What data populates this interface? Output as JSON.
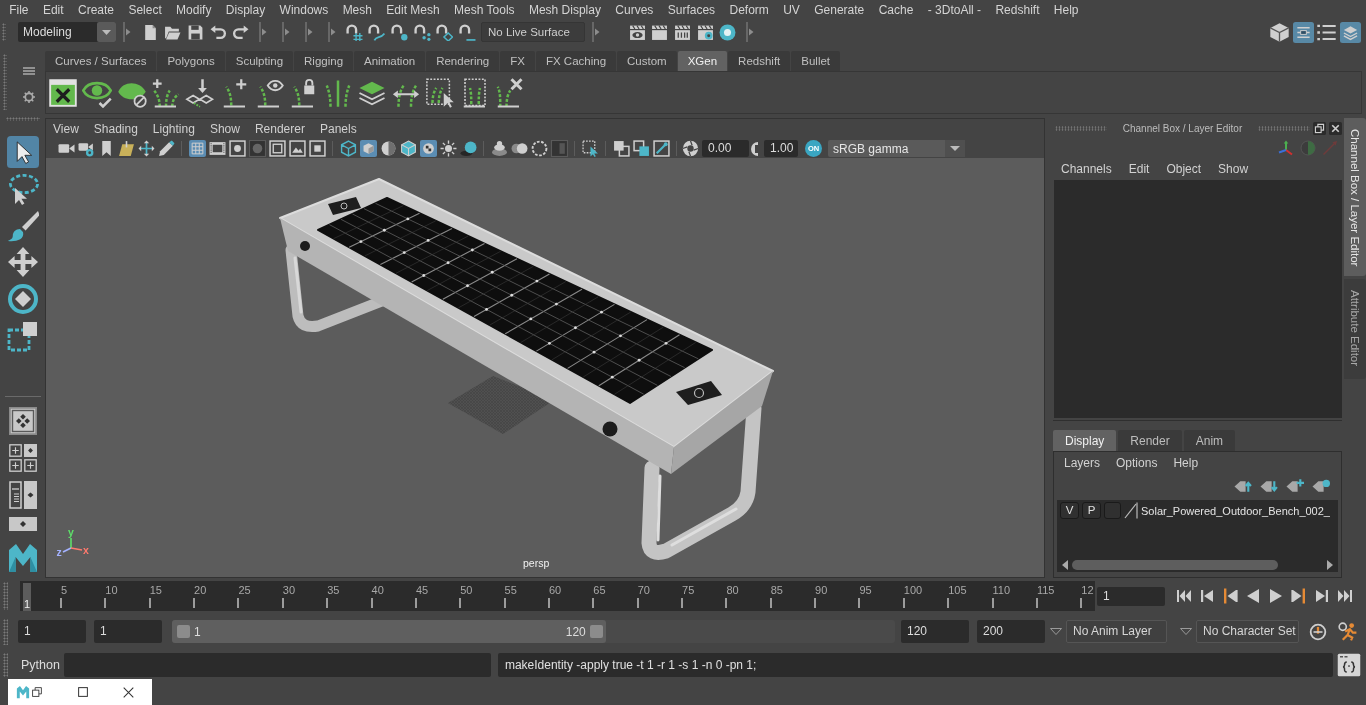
{
  "menu_bar": [
    "File",
    "Edit",
    "Create",
    "Select",
    "Modify",
    "Display",
    "Windows",
    "Mesh",
    "Edit Mesh",
    "Mesh Tools",
    "Mesh Display",
    "Curves",
    "Surfaces",
    "Deform",
    "UV",
    "Generate",
    "Cache",
    "- 3DtoAll -",
    "Redshift",
    "Help"
  ],
  "status_line": {
    "workspace": "Modeling",
    "live_surface": "No Live Surface",
    "panel_toggles": [
      {
        "selected": false
      },
      {
        "selected": true
      },
      {
        "selected": false
      },
      {
        "selected": true
      }
    ]
  },
  "shelf": {
    "tabs": [
      {
        "label": "Curves / Surfaces",
        "selected": false
      },
      {
        "label": "Polygons",
        "selected": false
      },
      {
        "label": "Sculpting",
        "selected": false
      },
      {
        "label": "Rigging",
        "selected": false
      },
      {
        "label": "Animation",
        "selected": false
      },
      {
        "label": "Rendering",
        "selected": false
      },
      {
        "label": "FX",
        "selected": false
      },
      {
        "label": "FX Caching",
        "selected": false
      },
      {
        "label": "Custom",
        "selected": false
      },
      {
        "label": "XGen",
        "selected": true
      },
      {
        "label": "Redshift",
        "selected": false
      },
      {
        "label": "Bullet",
        "selected": false
      }
    ]
  },
  "toolbox": {
    "tools": [
      {
        "selected": true
      },
      {
        "selected": false
      },
      {
        "selected": false
      },
      {
        "selected": false
      },
      {
        "selected": false
      },
      {
        "selected": false
      }
    ]
  },
  "viewport": {
    "menus": [
      "View",
      "Shading",
      "Lighting",
      "Show",
      "Renderer",
      "Panels"
    ],
    "toolbar": [
      {
        "selected": false
      },
      {
        "selected": false
      },
      {
        "selected": false
      },
      {
        "selected": false
      },
      {
        "selected": false
      },
      {
        "selected": false
      },
      {
        "selected": true
      },
      {
        "selected": false
      },
      {
        "selected": false
      },
      {
        "selected": false
      },
      {
        "selected": false
      },
      {
        "selected": false
      },
      {
        "selected": false
      },
      {
        "selected": false
      },
      {
        "selected": true
      },
      {
        "selected": false
      },
      {
        "selected": false
      },
      {
        "selected": true
      },
      {
        "selected": false
      },
      {
        "selected": false
      },
      {
        "selected": false
      },
      {
        "selected": false
      },
      {
        "selected": false
      },
      {
        "selected": false
      },
      {
        "selected": false
      },
      {
        "selected": false
      },
      {
        "selected": false
      },
      {
        "selected": false
      }
    ],
    "exposure": "0.00",
    "gamma": "1.00",
    "color_management": "ON",
    "color_space": "sRGB gamma",
    "axis_gizmo": [
      {
        "label": "y",
        "color": "#5ee06a"
      },
      {
        "label": "z",
        "color": "#a4b2ff"
      },
      {
        "label": "x",
        "color": "#ff7a6e"
      }
    ],
    "camera": "persp"
  },
  "channel_box": {
    "title": "Channel Box / Layer Editor",
    "menus": [
      "Channels",
      "Edit",
      "Object",
      "Show"
    ]
  },
  "layer_editor": {
    "tabs": [
      {
        "label": "Display",
        "selected": true
      },
      {
        "label": "Render",
        "selected": false
      },
      {
        "label": "Anim",
        "selected": false
      }
    ],
    "menus": [
      "Layers",
      "Options",
      "Help"
    ],
    "layers": [
      {
        "visibility": "V",
        "playback": "P",
        "name": "Solar_Powered_Outdoor_Bench_002_"
      }
    ]
  },
  "side_tabs": [
    {
      "label": "Channel Box / Layer Editor",
      "selected": true
    },
    {
      "label": "Attribute Editor",
      "selected": false
    }
  ],
  "time_slider": {
    "ticks": [
      "5",
      "10",
      "15",
      "20",
      "25",
      "30",
      "35",
      "40",
      "45",
      "50",
      "55",
      "60",
      "65",
      "70",
      "75",
      "80",
      "85",
      "90",
      "95",
      "100",
      "105",
      "110",
      "115",
      "12"
    ],
    "current_frame": "1",
    "level": 0,
    "frame_field": "1"
  },
  "range_slider": {
    "start": "1",
    "playback_start": "1",
    "range_start": "1",
    "range_end": "120",
    "level": 0.6,
    "playback_end": "120",
    "end": "200",
    "anim_layer": "No Anim Layer",
    "character_set": "No Character Set"
  },
  "command_line": {
    "language": "Python",
    "result": "makeIdentity -apply true -t 1 -r 1 -s 1 -n 0 -pn 1;"
  }
}
